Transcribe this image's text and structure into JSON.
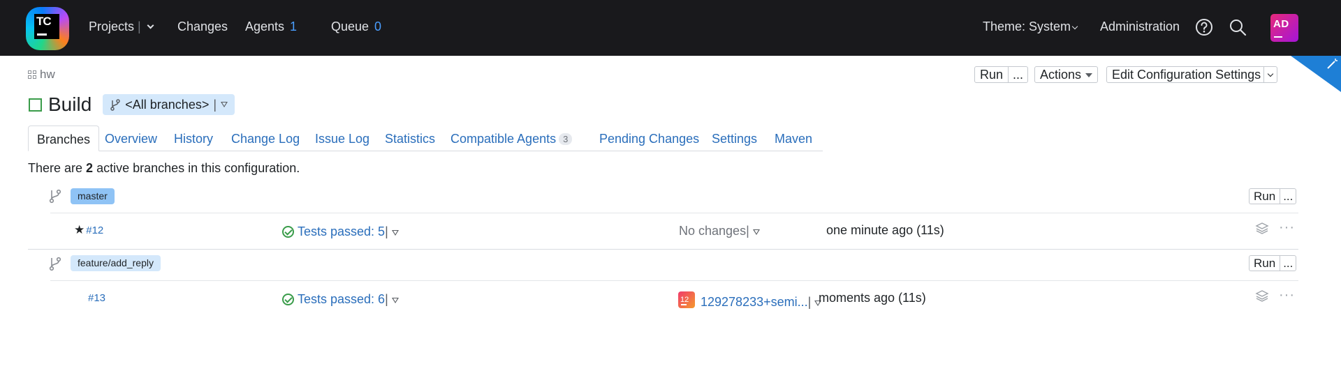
{
  "header": {
    "logo_text": "TC",
    "nav": {
      "projects": "Projects",
      "changes": "Changes",
      "agents": "Agents",
      "agents_count": "1",
      "queue": "Queue",
      "queue_count": "0"
    },
    "theme": "Theme: System",
    "administration": "Administration",
    "avatar_initials": "AD",
    "icons": [
      "help-icon",
      "search-icon"
    ]
  },
  "breadcrumb": {
    "project": "hw"
  },
  "toolbar": {
    "run": "Run",
    "more": "...",
    "actions": "Actions",
    "edit": "Edit Configuration Settings"
  },
  "page": {
    "title": "Build",
    "branch_selector": "<All branches>"
  },
  "tabs": [
    {
      "label": "Branches"
    },
    {
      "label": "Overview"
    },
    {
      "label": "History"
    },
    {
      "label": "Change Log"
    },
    {
      "label": "Issue Log"
    },
    {
      "label": "Statistics"
    },
    {
      "label": "Compatible Agents",
      "badge": "3"
    },
    {
      "label": "Pending Changes"
    },
    {
      "label": "Settings"
    },
    {
      "label": "Maven"
    }
  ],
  "summary": {
    "prefix": "There are ",
    "count": "2",
    "suffix": " active branches in this configuration."
  },
  "branches": [
    {
      "name": "master",
      "run": "Run",
      "more": "...",
      "build": {
        "number": "#12",
        "starred": true,
        "status": "Tests passed: 5",
        "changes": "No changes",
        "time": "one minute ago (11s)"
      }
    },
    {
      "name": "feature/add_reply",
      "run": "Run",
      "more": "...",
      "build": {
        "number": "#13",
        "starred": false,
        "status": "Tests passed: 6",
        "changes_avatar": "12",
        "changes": "129278233+semi...",
        "time": "moments ago (11s)"
      }
    }
  ],
  "row_actions": "···",
  "colors": {
    "header_bg": "#19191c",
    "link": "#2a6ebb",
    "success": "#3a9c4a",
    "accent_count": "#4a9eff",
    "branch_tag": "#8fc3f5",
    "branch_tag_light": "#d4e8fb"
  }
}
